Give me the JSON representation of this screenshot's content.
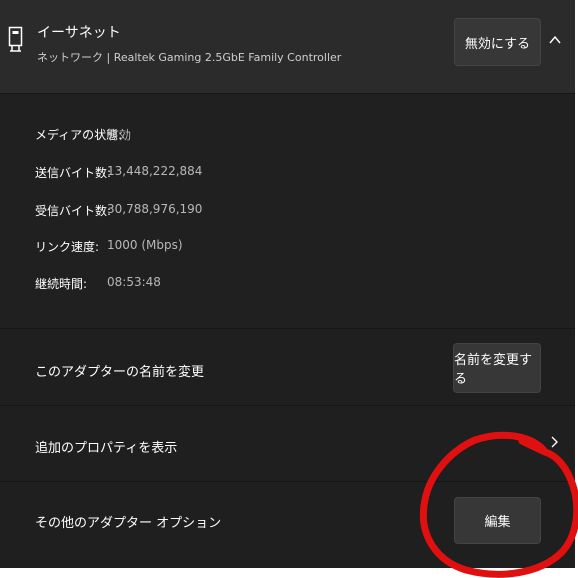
{
  "header": {
    "title": "イーサネット",
    "subtitle": "ネットワーク | Realtek Gaming 2.5GbE Family Controller",
    "disable_button": "無効にする",
    "collapse_icon": "chevron-up-icon",
    "adapter_icon": "ethernet-icon"
  },
  "details": [
    {
      "label": "メディアの状態:",
      "value": "有効"
    },
    {
      "label": "送信バイト数:",
      "value": "13,448,222,884"
    },
    {
      "label": "受信バイト数:",
      "value": "30,788,976,190"
    },
    {
      "label": "リンク速度:",
      "value": "1000 (Mbps)"
    },
    {
      "label": "継続時間:",
      "value": "08:53:48"
    }
  ],
  "options": {
    "rename_label": "このアダプターの名前を変更",
    "rename_button": "名前を変更する",
    "properties_label": "追加のプロパティを表示",
    "other_label": "その他のアダプター オプション",
    "edit_button": "編集"
  },
  "colors": {
    "panel_bg": "#1f1f1f",
    "header_bg": "#2b2b2b",
    "button_bg": "#373737",
    "annotation": "#e01010"
  }
}
